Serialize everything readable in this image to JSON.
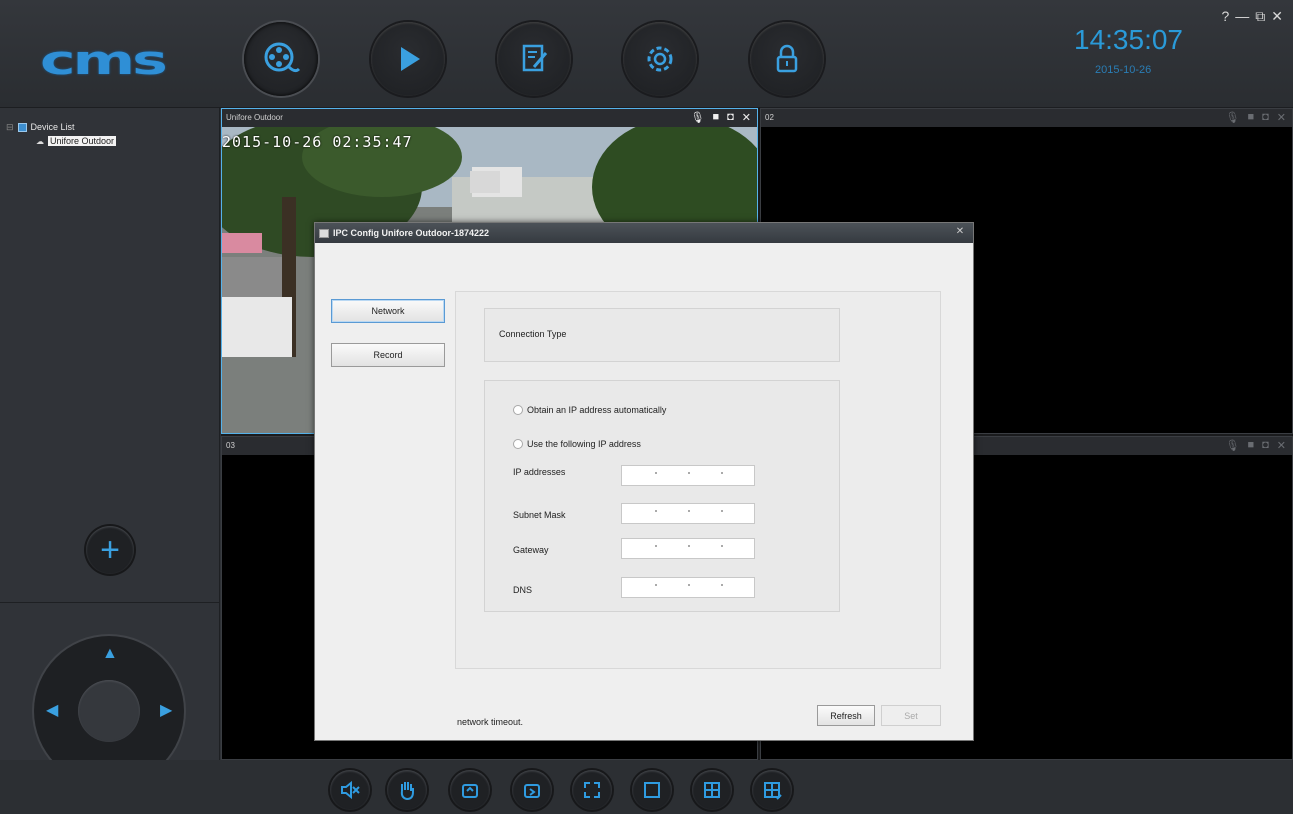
{
  "app": {
    "logo": "cms",
    "clock": "14:35:07",
    "date": "2015-10-26",
    "window_controls": [
      "?",
      "—",
      "⧉",
      "✕"
    ],
    "accent_color": "#2f9be0"
  },
  "toolbar": {
    "buttons": [
      {
        "name": "live-view",
        "icon": "camera-reel-icon"
      },
      {
        "name": "playback",
        "icon": "play-icon"
      },
      {
        "name": "log",
        "icon": "edit-document-icon"
      },
      {
        "name": "settings",
        "icon": "gear-icon"
      },
      {
        "name": "lock",
        "icon": "lock-icon"
      }
    ]
  },
  "device_tree": {
    "root_label": "Device List",
    "device_label": "Unifore Outdoor"
  },
  "channels": [
    {
      "title": "Unifore Outdoor",
      "osd": "2015-10-26  02:35:47"
    },
    {
      "title": "02"
    },
    {
      "title": "03"
    },
    {
      "title": ""
    }
  ],
  "dialog": {
    "title": "IPC Config Unifore Outdoor-1874222",
    "nav": {
      "network": "Network",
      "record": "Record"
    },
    "connection_type_label": "Connection Type",
    "radio_auto": "Obtain an IP address automatically",
    "radio_manual": "Use the following IP address",
    "fields": {
      "ip": "IP addresses",
      "subnet": "Subnet Mask",
      "gateway": "Gateway",
      "dns": "DNS"
    },
    "status": "network timeout.",
    "refresh_label": "Refresh",
    "set_label": "Set"
  },
  "bottom_toolbar": {
    "icons": [
      "mute-icon",
      "hand-icon",
      "screenshot-icon",
      "export-icon",
      "fullscreen-icon",
      "single-view-icon",
      "quad-view-icon",
      "custom-layout-icon"
    ]
  }
}
